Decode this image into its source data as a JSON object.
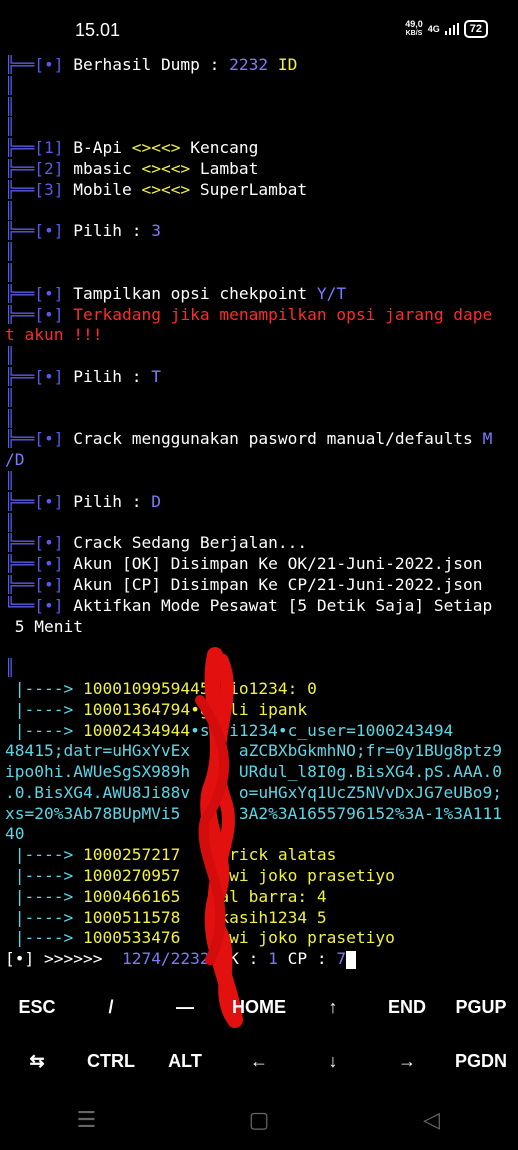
{
  "status_bar": {
    "time": "15.01",
    "speed_value": "49,0",
    "speed_unit": "KB/S",
    "network": "4G",
    "battery": "72"
  },
  "terminal": {
    "dump": {
      "prefix": "╠══[•]",
      "label": " Berhasil Dump : ",
      "count": "2232",
      "suffix": " ID"
    },
    "menu": [
      {
        "prefix": "╠══[1]",
        "name": " B-Api ",
        "sep": "<><<>",
        "speed": " Kencang"
      },
      {
        "prefix": "╠══[2]",
        "name": " mbasic ",
        "sep": "<><<>",
        "speed": " Lambat"
      },
      {
        "prefix": "╠══[3]",
        "name": " Mobile ",
        "sep": "<><<>",
        "speed": " SuperLambat"
      }
    ],
    "pilih1": {
      "prefix": "╠══[•]",
      "label": " Pilih : ",
      "value": "3"
    },
    "checkpoint": {
      "prefix": "╠══[•]",
      "label": " Tampilkan opsi chekpoint ",
      "value": "Y/T"
    },
    "warning": {
      "prefix": "╠══[•]",
      "line1": " Terkadang jika menampilkan opsi jarang dape",
      "line2": "t akun !!!"
    },
    "pilih2": {
      "prefix": "╠══[•]",
      "label": " Pilih : ",
      "value": "T"
    },
    "crack_opt": {
      "prefix": "╠══[•]",
      "label": " Crack menggunakan pasword manual/defaults ",
      "value1": "M",
      "value2": "/D"
    },
    "pilih3": {
      "prefix": "╠══[•]",
      "label": " Pilih : ",
      "value": "D"
    },
    "running": [
      {
        "prefix": "╠══[•]",
        "text": " Crack Sedang Berjalan..."
      },
      {
        "prefix": "╠══[•]",
        "text": " Akun [OK] Disimpan Ke OK/21-Juni-2022.json"
      },
      {
        "prefix": "╠══[•]",
        "text": " Akun [CP] Disimpan Ke CP/21-Juni-2022.json"
      },
      {
        "prefix": "╚══[•]",
        "text": " Aktifkan Mode Pesawat [5 Detik Saja] Setiap"
      }
    ],
    "running_cont": " 5 Menit",
    "results": [
      {
        "arrow": " |----> ",
        "uid": "10001099594",
        "hidden": "4",
        "rest": "5•rio1234: 0"
      },
      {
        "arrow": " |----> ",
        "uid": "1000136479",
        "hidden": "4",
        "rest": "•gioli ipank"
      },
      {
        "arrow": " |----> ",
        "uid": "10002434944",
        "hidden": "",
        "rest": "•susi1234•c_user=1000243494"
      }
    ],
    "cookie_lines": [
      "48415;datr=uHGxYvEx     aZCBXbGkmhNO;fr=0y1BUg8ptz9",
      "ipo0hi.AWUeSgSX989h     URdul_l8I0g.BisXG4.pS.AAA.0",
      ".0.BisXG4.AWU8Ji88v     o=uHGxYq1UcZ5NVvDxJG7eUBo9;",
      "xs=20%3Ab78BUpMVi5      3A2%3A1655796152%3A-1%3A111",
      "40"
    ],
    "results2": [
      {
        "arrow": " |----> ",
        "uid": "1000257217",
        "rest": "    erick alatas"
      },
      {
        "arrow": " |----> ",
        "uid": "1000270957",
        "rest": "    dwi joko prasetiyo"
      },
      {
        "arrow": " |----> ",
        "uid": "1000466165",
        "rest": "    al barra: 4"
      },
      {
        "arrow": " |----> ",
        "uid": "1000511578",
        "rest": "    kasih1234 5"
      },
      {
        "arrow": " |----> ",
        "uid": "1000533476",
        "rest": "    dwi joko prasetiyo"
      }
    ],
    "progress": {
      "prefix": "[•] >>>>>>  ",
      "count": "1274/2232",
      "ok_label": " OK : ",
      "ok": "1",
      "cp_label": " CP : ",
      "cp": "7"
    }
  },
  "extra_keys": {
    "row1": [
      "ESC",
      "/",
      "—",
      "HOME",
      "↑",
      "END",
      "PGUP"
    ],
    "row2": [
      "⇆",
      "CTRL",
      "ALT",
      "←",
      "↓",
      "→",
      "PGDN"
    ]
  },
  "nav_bar": {
    "recents": "☰",
    "home": "▢",
    "back": "◁"
  }
}
